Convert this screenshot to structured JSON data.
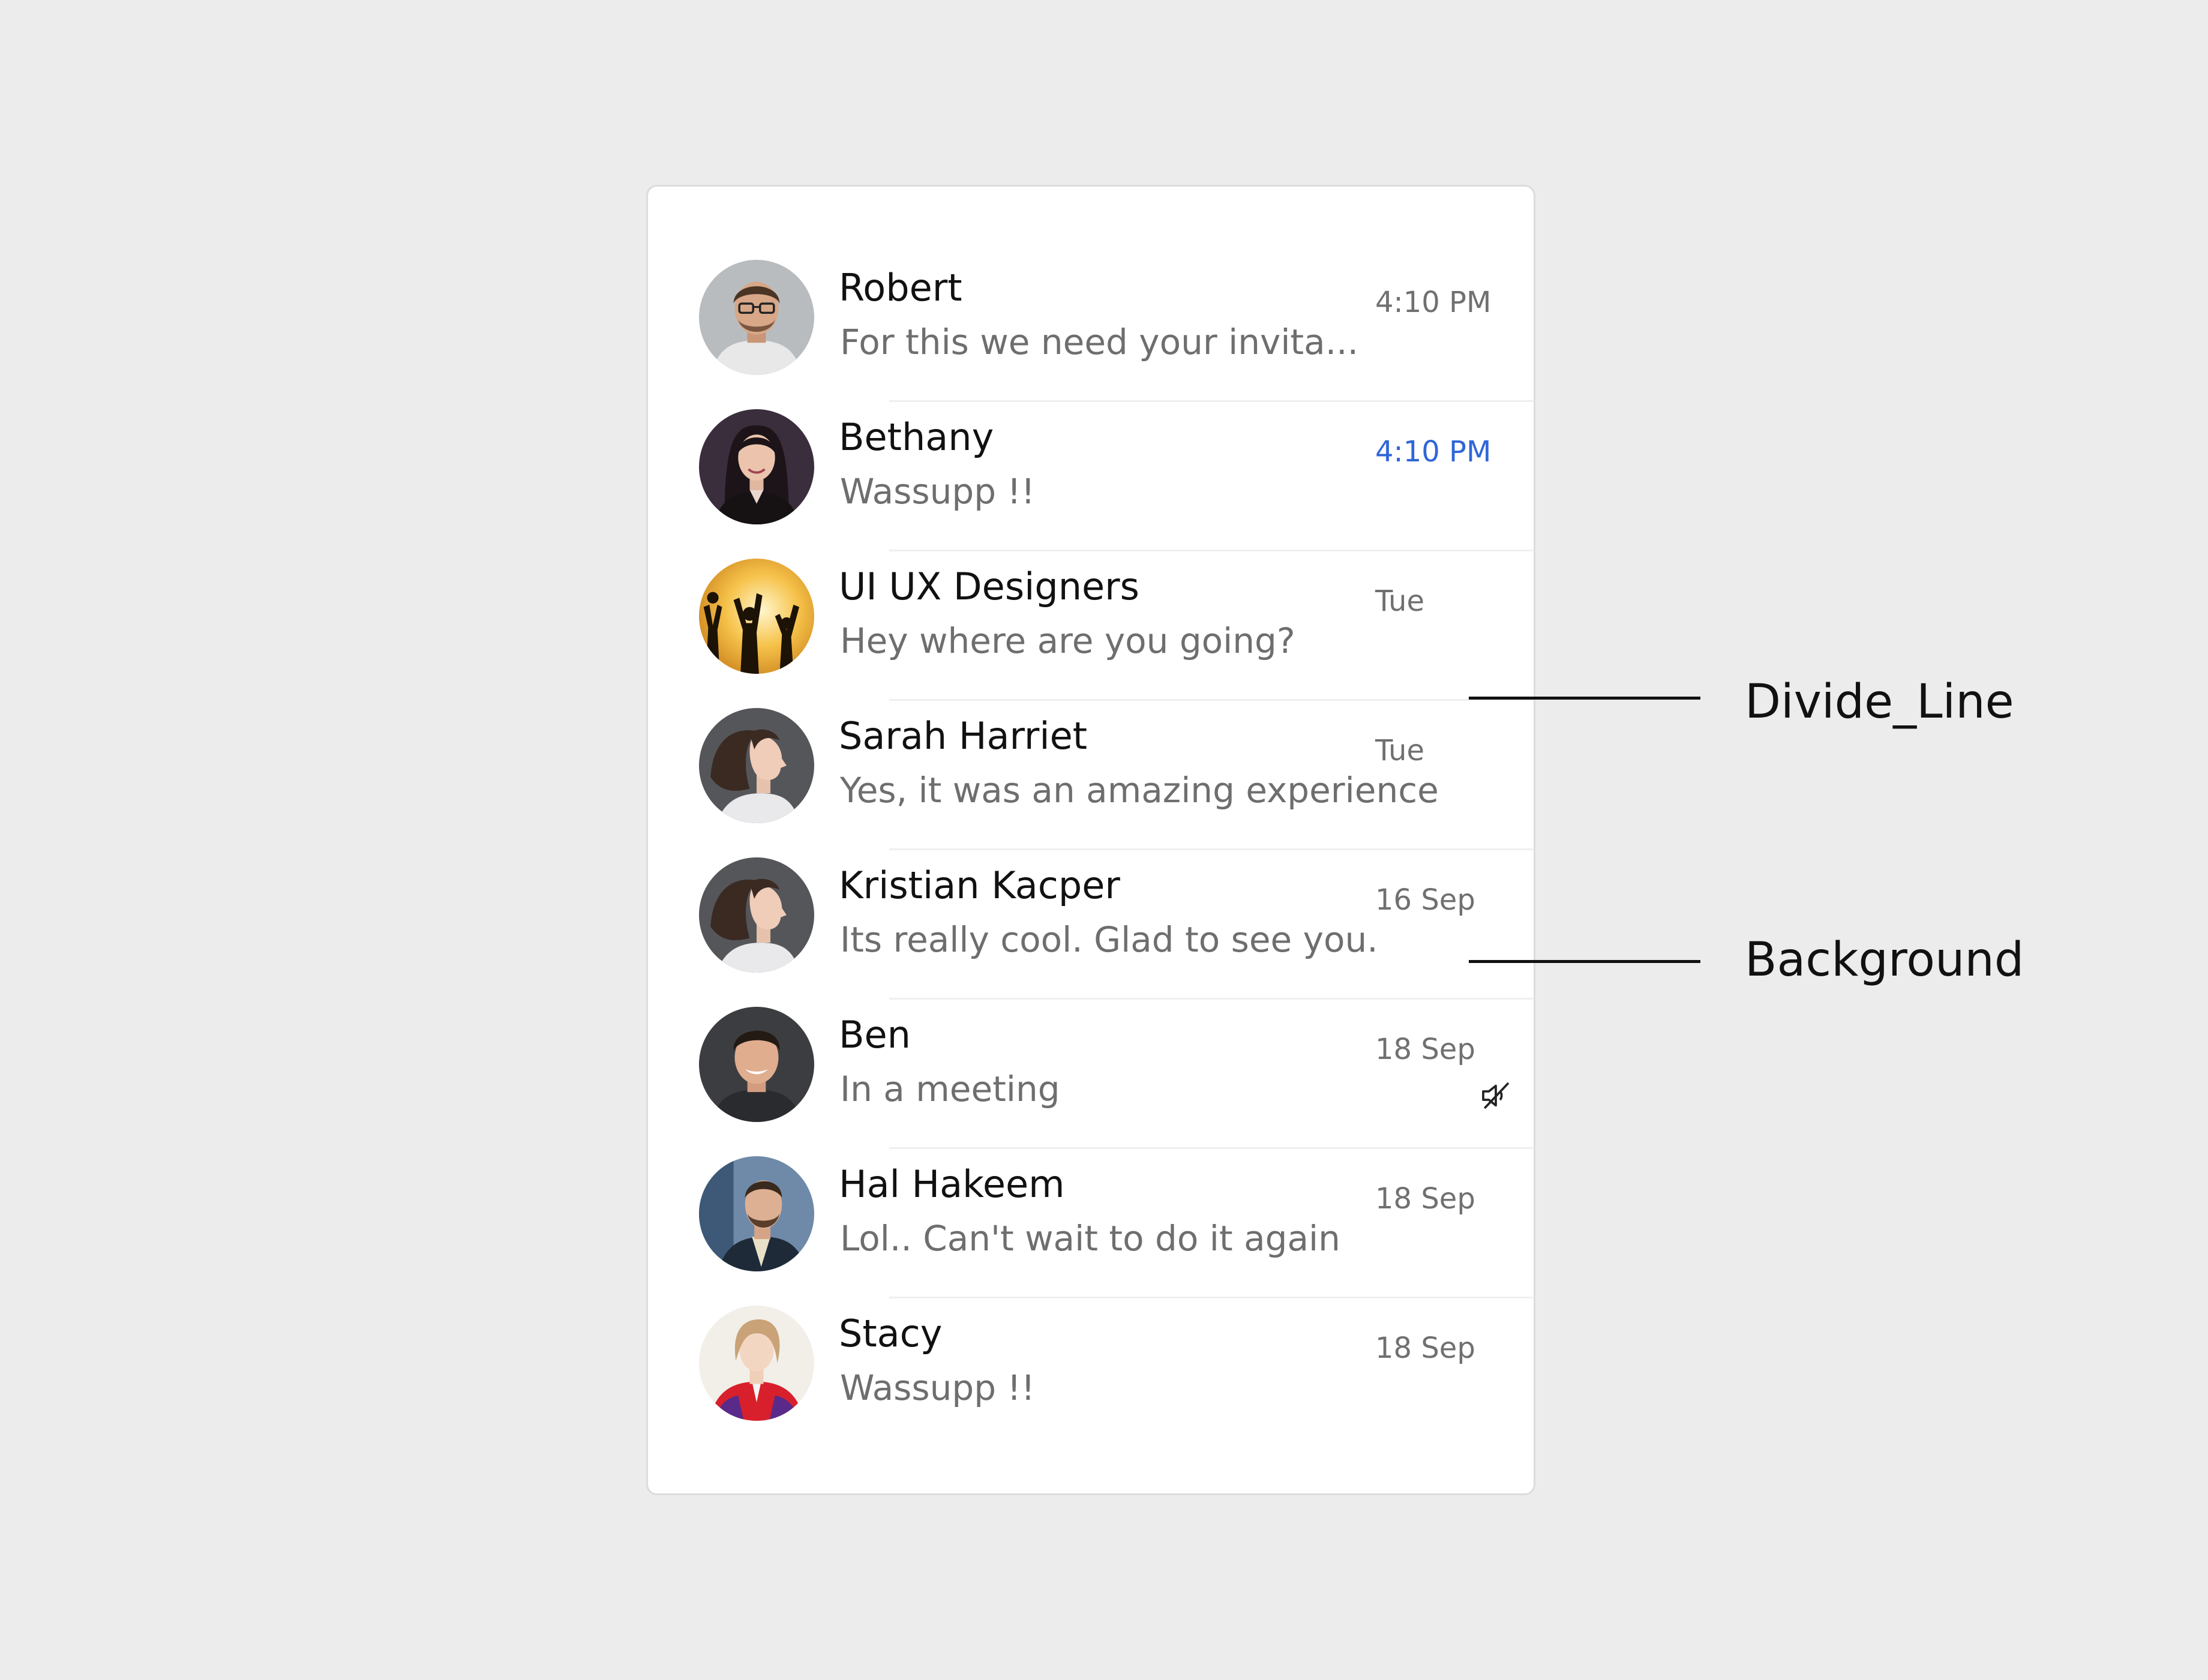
{
  "chats": [
    {
      "name": "Robert",
      "preview": "For this we need your invita...",
      "time": "4:10 PM",
      "unread": false,
      "muted": false,
      "avatar_icon": "person-avatar-icon"
    },
    {
      "name": "Bethany",
      "preview": "Wassupp !!",
      "time": "4:10 PM",
      "unread": true,
      "muted": false,
      "avatar_icon": "person-avatar-icon"
    },
    {
      "name": "UI UX Designers",
      "preview": "Hey where are you going?",
      "time": "Tue",
      "unread": false,
      "muted": false,
      "avatar_icon": "group-avatar-icon"
    },
    {
      "name": "Sarah Harriet",
      "preview": "Yes, it was an amazing experience",
      "time": "Tue",
      "unread": false,
      "muted": false,
      "avatar_icon": "person-avatar-icon"
    },
    {
      "name": "Kristian Kacper",
      "preview": "Its really cool. Glad to see you.",
      "time": "16 Sep",
      "unread": false,
      "muted": false,
      "avatar_icon": "person-avatar-icon"
    },
    {
      "name": "Ben",
      "preview": "In a meeting",
      "time": "18 Sep",
      "unread": false,
      "muted": true,
      "avatar_icon": "person-avatar-icon",
      "status_icon": "muted-speaker-icon"
    },
    {
      "name": "Hal Hakeem",
      "preview": "Lol.. Can't wait to do it again",
      "time": "18 Sep",
      "unread": false,
      "muted": false,
      "avatar_icon": "person-avatar-icon"
    },
    {
      "name": "Stacy",
      "preview": "Wassupp !!",
      "time": "18 Sep",
      "unread": false,
      "muted": false,
      "avatar_icon": "person-avatar-icon"
    }
  ],
  "annotations": {
    "divide_line": "Divide_Line",
    "background": "Background"
  },
  "colors": {
    "page_background": "#ececec",
    "card_background": "#ffffff",
    "unread_time": "#2f66d8",
    "name_text": "#111111",
    "preview_text": "#6e6e6e"
  }
}
